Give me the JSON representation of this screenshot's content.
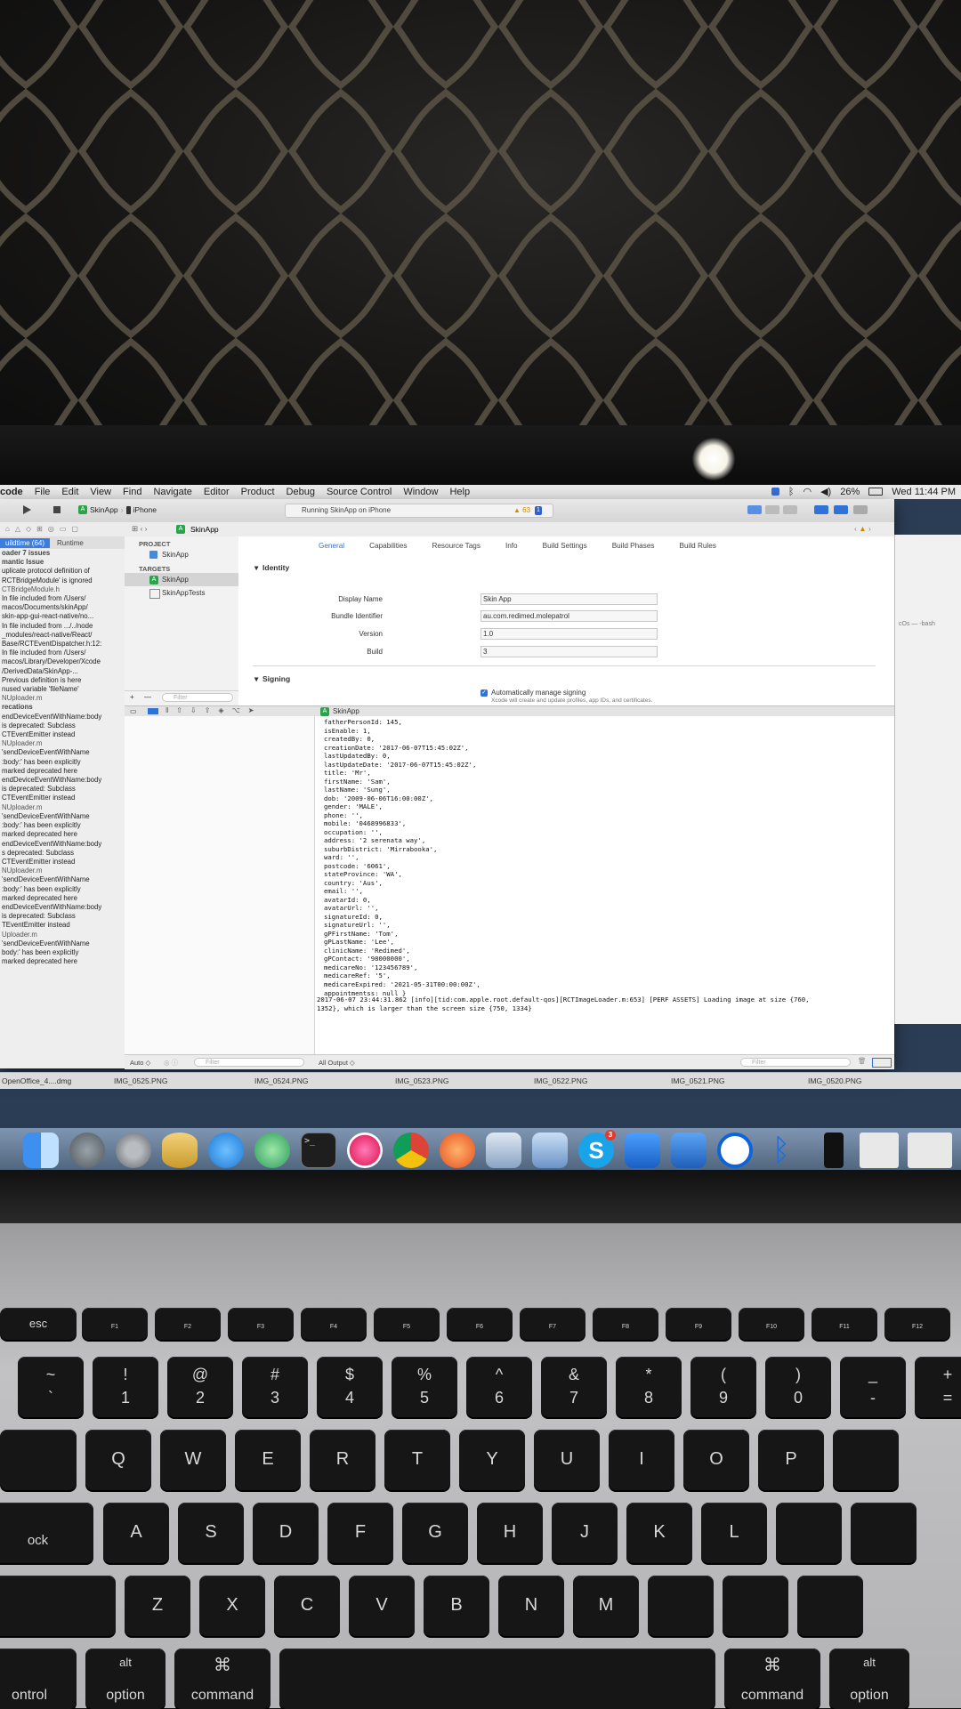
{
  "menubar": {
    "app": "code",
    "items": [
      "File",
      "Edit",
      "View",
      "Find",
      "Navigate",
      "Editor",
      "Product",
      "Debug",
      "Source Control",
      "Window",
      "Help"
    ],
    "battery": "26%",
    "clock": "Wed 11:44 PM"
  },
  "toolbar": {
    "scheme": "SkinApp",
    "device": "iPhone",
    "status": "Running SkinApp on iPhone",
    "warnings": "63",
    "errors": "1"
  },
  "breadcrumb": "SkinApp",
  "navigator": {
    "tabs": [
      "uildtime (64)",
      "Runtime"
    ],
    "issues": [
      {
        "t": "oader 7 issues",
        "k": "head"
      },
      {
        "t": "mantic Issue",
        "k": "head"
      },
      {
        "t": "uplicate protocol definition of",
        "k": ""
      },
      {
        "t": "RCTBridgeModule' is ignored",
        "k": ""
      },
      {
        "t": "CTBridgeModule.h",
        "k": "file"
      },
      {
        "t": "In file included from /Users/",
        "k": ""
      },
      {
        "t": "macos/Documents/skinApp/",
        "k": ""
      },
      {
        "t": "skin-app-gui-react-native/no...",
        "k": ""
      },
      {
        "t": "In file included from .../../node",
        "k": ""
      },
      {
        "t": "_modules/react-native/React/",
        "k": ""
      },
      {
        "t": "Base/RCTEventDispatcher.h:12:",
        "k": ""
      },
      {
        "t": "In file included from /Users/",
        "k": ""
      },
      {
        "t": "macos/Library/Developer/Xcode",
        "k": ""
      },
      {
        "t": "/DerivedData/SkinApp-...",
        "k": ""
      },
      {
        "t": "Previous definition is here",
        "k": ""
      },
      {
        "t": "nused variable 'fileName'",
        "k": ""
      },
      {
        "t": "NUploader.m",
        "k": "file"
      },
      {
        "t": "recations",
        "k": "head"
      },
      {
        "t": "endDeviceEventWithName:body",
        "k": ""
      },
      {
        "t": "is deprecated: Subclass",
        "k": ""
      },
      {
        "t": "CTEventEmitter instead",
        "k": ""
      },
      {
        "t": "NUploader.m",
        "k": "file"
      },
      {
        "t": "'sendDeviceEventWithName",
        "k": ""
      },
      {
        "t": ":body:' has been explicitly",
        "k": ""
      },
      {
        "t": "marked deprecated here",
        "k": ""
      },
      {
        "t": "endDeviceEventWithName:body",
        "k": ""
      },
      {
        "t": "is deprecated: Subclass",
        "k": ""
      },
      {
        "t": "CTEventEmitter instead",
        "k": ""
      },
      {
        "t": "NUploader.m",
        "k": "file"
      },
      {
        "t": "'sendDeviceEventWithName",
        "k": ""
      },
      {
        "t": ":body:' has been explicitly",
        "k": ""
      },
      {
        "t": "marked deprecated here",
        "k": ""
      },
      {
        "t": "endDeviceEventWithName:body",
        "k": ""
      },
      {
        "t": "s deprecated: Subclass",
        "k": ""
      },
      {
        "t": "CTEventEmitter instead",
        "k": ""
      },
      {
        "t": "NUploader.m",
        "k": "file"
      },
      {
        "t": "'sendDeviceEventWithName",
        "k": ""
      },
      {
        "t": ":body:' has been explicitly",
        "k": ""
      },
      {
        "t": "marked deprecated here",
        "k": ""
      },
      {
        "t": "endDeviceEventWithName:body",
        "k": ""
      },
      {
        "t": "is deprecated: Subclass",
        "k": ""
      },
      {
        "t": "TEventEmitter instead",
        "k": ""
      },
      {
        "t": "Uploader.m",
        "k": "file"
      },
      {
        "t": "'sendDeviceEventWithName",
        "k": ""
      },
      {
        "t": "body:' has been explicitly",
        "k": ""
      },
      {
        "t": "marked deprecated here",
        "k": ""
      }
    ]
  },
  "outline": {
    "project_header": "PROJECT",
    "project": "SkinApp",
    "targets_header": "TARGETS",
    "target1": "SkinApp",
    "target2": "SkinAppTests",
    "filter_placeholder": "Filter"
  },
  "editor": {
    "tabs": [
      "General",
      "Capabilities",
      "Resource Tags",
      "Info",
      "Build Settings",
      "Build Phases",
      "Build Rules"
    ],
    "identity_title": "Identity",
    "rows": [
      {
        "label": "Display Name",
        "value": "Skin App"
      },
      {
        "label": "Bundle Identifier",
        "value": "au.com.redimed.molepatrol"
      },
      {
        "label": "Version",
        "value": "1.0"
      },
      {
        "label": "Build",
        "value": "3"
      }
    ],
    "signing_title": "Signing",
    "auto_sign": "Automatically manage signing",
    "auto_sign_note": "Xcode will create and update profiles, app IDs, and certificates."
  },
  "debug": {
    "target": "SkinApp",
    "console_lines": [
      "fatherPersonId: 145,",
      "isEnable: 1,",
      "createdBy: 0,",
      "creationDate: '2017-06-07T15:45:02Z',",
      "lastUpdatedBy: 0,",
      "lastUpdateDate: '2017-06-07T15:45:02Z',",
      "title: 'Mr',",
      "firstName: 'Sam',",
      "lastName: 'Sung',",
      "dob: '2009-06-06T16:00:00Z',",
      "gender: 'MALE',",
      "phone: '',",
      "mobile: '0468996833',",
      "occupation: '',",
      "address: '2 serenata way',",
      "suburbDistrict: 'Mirrabooka',",
      "ward: '',",
      "postcode: '6061',",
      "stateProvince: 'WA',",
      "country: 'Aus',",
      "email: '',",
      "avatarId: 0,",
      "avatarUrl: '',",
      "signatureId: 0,",
      "signatureUrl: '',",
      "gPFirstName: 'Tom',",
      "gPLastName: 'Lee',",
      "clinicName: 'Redimed',",
      "gPContact: '98000000',",
      "medicareNo: '123456789',",
      "medicareRef: '5',",
      "medicareExpired: '2021-05-31T00:00:00Z',",
      "appointmentss: null }"
    ],
    "log_line_1": "2017-06-07 23:44:31.862 [info][tid:com.apple.root.default-qos][RCTImageLoader.m:653] [PERF ASSETS] Loading image at size {760,",
    "log_line_2": "1352}, which is larger than the screen size {750, 1334}",
    "auto_label": "Auto",
    "filter_placeholder": "Filter",
    "output_label": "All Output"
  },
  "terminal_title": "cOs — -bash",
  "files": [
    "OpenOffice_4....dmg",
    "IMG_0525.PNG",
    "IMG_0524.PNG",
    "IMG_0523.PNG",
    "IMG_0522.PNG",
    "IMG_0521.PNG",
    "IMG_0520.PNG"
  ],
  "dock": {
    "icons": [
      "finder-icon",
      "launchpad-icon",
      "system-preferences-icon",
      "sequel-icon",
      "messages-icon",
      "atom-icon",
      "terminal-icon",
      "itunes-icon",
      "chrome-icon",
      "instruments-icon",
      "preview-icon",
      "xcode-icon",
      "skype-icon",
      "xcode-beta-icon",
      "screens-icon",
      "teamviewer-icon",
      "bluetooth-icon",
      "simulator-icon"
    ],
    "skype_badge": "3"
  },
  "keyboard": {
    "fn_row": [
      "esc",
      "F1",
      "F2",
      "F3",
      "F4",
      "F5",
      "F6",
      "F7",
      "F8",
      "F9",
      "F10",
      "F11",
      "F12"
    ],
    "num_row": [
      [
        "~",
        "`"
      ],
      [
        "!",
        "1"
      ],
      [
        "@",
        "2"
      ],
      [
        "#",
        "3"
      ],
      [
        "$",
        "4"
      ],
      [
        "%",
        "5"
      ],
      [
        "^",
        "6"
      ],
      [
        "&",
        "7"
      ],
      [
        "*",
        "8"
      ],
      [
        "(",
        "9"
      ],
      [
        ")",
        "0"
      ],
      [
        "_",
        "-"
      ],
      [
        "+",
        "="
      ]
    ],
    "q_row": [
      "Q",
      "W",
      "E",
      "R",
      "T",
      "Y",
      "U",
      "I",
      "O",
      "P"
    ],
    "a_row": [
      "A",
      "S",
      "D",
      "F",
      "G",
      "H",
      "J",
      "K",
      "L"
    ],
    "z_row": [
      "Z",
      "X",
      "C",
      "V",
      "B",
      "N",
      "M"
    ],
    "caps": "ock",
    "control": "ontrol",
    "option": "option",
    "alt": "alt",
    "command": "command",
    "cmd_symbol": "⌘"
  }
}
